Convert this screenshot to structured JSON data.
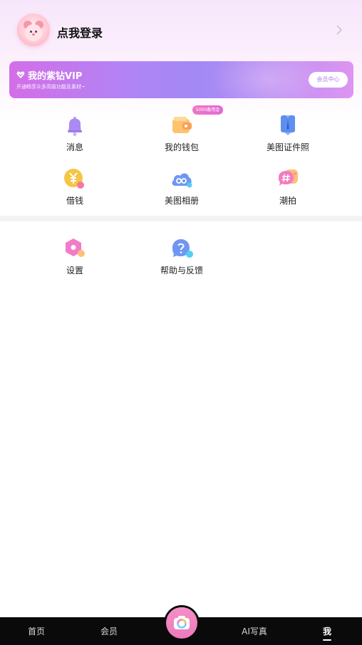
{
  "header": {
    "login_text": "点我登录"
  },
  "vip": {
    "title": "我的紫钻VIP",
    "subtitle": "开通畅享众多高级功能及素材~",
    "button": "会员中心"
  },
  "menu": {
    "row1": [
      {
        "label": "消息",
        "icon": "bell-icon"
      },
      {
        "label": "我的钱包",
        "icon": "wallet-icon",
        "badge": "5000备用金"
      },
      {
        "label": "美图证件照",
        "icon": "id-photo-icon"
      }
    ],
    "row2": [
      {
        "label": "借钱",
        "icon": "yen-coin-icon"
      },
      {
        "label": "美图相册",
        "icon": "cloud-album-icon"
      },
      {
        "label": "潮拍",
        "icon": "hashtag-bubble-icon"
      }
    ],
    "row3": [
      {
        "label": "设置",
        "icon": "settings-hexagon-icon"
      },
      {
        "label": "帮助与反馈",
        "icon": "help-bubble-icon"
      }
    ]
  },
  "bottom_nav": {
    "items": [
      {
        "label": "首页"
      },
      {
        "label": "会员"
      },
      {
        "label": "AI写真"
      },
      {
        "label": "我",
        "active": true
      }
    ],
    "camera_icon": "camera-icon"
  },
  "colors": {
    "accent_pink": "#ee79bd",
    "vip_purple": "#a289f4",
    "nav_bg": "#0a0a0a"
  }
}
